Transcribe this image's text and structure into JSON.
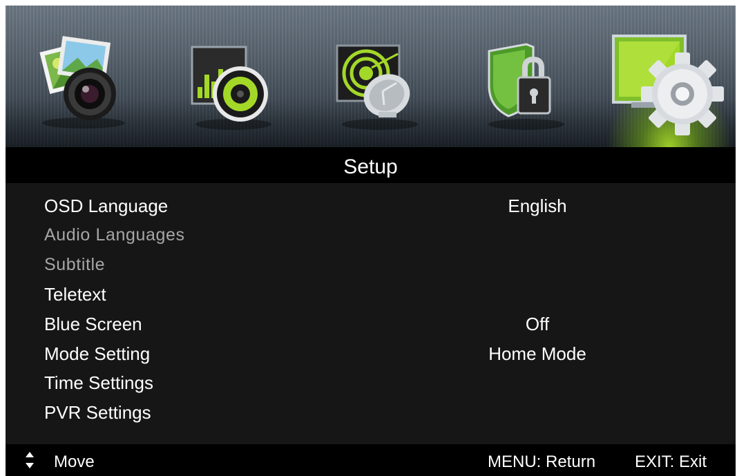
{
  "menu_title": "Setup",
  "tabs": [
    {
      "icon": "picture-camera-icon"
    },
    {
      "icon": "sound-speaker-icon"
    },
    {
      "icon": "channel-satellite-icon"
    },
    {
      "icon": "lock-shield-icon"
    },
    {
      "icon": "setup-gear-icon",
      "active": true
    }
  ],
  "items": [
    {
      "label": "OSD Language",
      "value": "English",
      "enabled": true
    },
    {
      "label": "Audio Languages",
      "value": "",
      "enabled": false
    },
    {
      "label": "Subtitle",
      "value": "",
      "enabled": false
    },
    {
      "label": "Teletext",
      "value": "",
      "enabled": true
    },
    {
      "label": "Blue Screen",
      "value": "Off",
      "enabled": true
    },
    {
      "label": "Mode Setting",
      "value": "Home Mode",
      "enabled": true
    },
    {
      "label": "Time Settings",
      "value": "",
      "enabled": true
    },
    {
      "label": "PVR Settings",
      "value": "",
      "enabled": true
    }
  ],
  "footer": {
    "move": "Move",
    "menu_return": "MENU: Return",
    "exit": "EXIT: Exit"
  },
  "colors": {
    "accent_green": "#a3d828",
    "menu_background": "#161616",
    "disabled_text": "#a6a6a6"
  }
}
